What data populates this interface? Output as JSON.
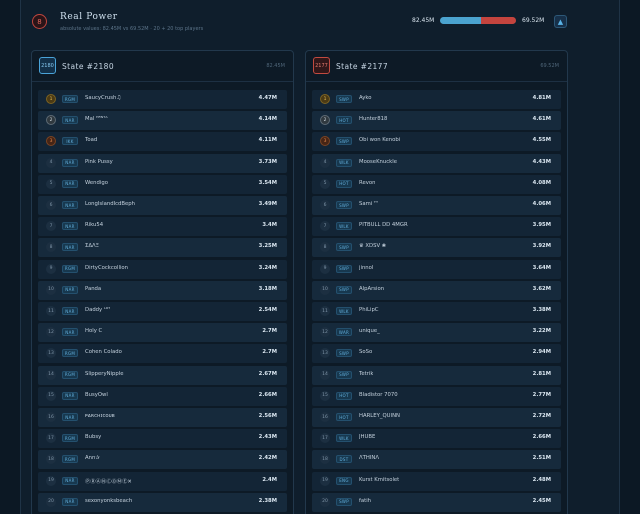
{
  "header": {
    "crest": "8",
    "title": "Real Power",
    "subtitle": "absolute values: 82.45M vs 69.52M · 20 + 20 top players",
    "left_value": "82.45M",
    "right_value": "69.52M",
    "power_split": 0.5425,
    "collapse_icon": "▲",
    "colors": {
      "left": "#4ba3cf",
      "right": "#c4443e"
    }
  },
  "left": {
    "badge": "2180",
    "title": "State #2180",
    "total": "82.45M",
    "players": [
      {
        "rank": "1",
        "tag": "RGM",
        "name": "SaucyCrush♫",
        "value": "4.47M"
      },
      {
        "rank": "2",
        "tag": "NAR",
        "name": "Mal ᴴᴿᴺᵀᴬ",
        "value": "4.14M"
      },
      {
        "rank": "3",
        "tag": "IKK",
        "name": "Toad",
        "value": "4.11M"
      },
      {
        "rank": "4",
        "tag": "NAR",
        "name": "Pink Pussy",
        "value": "3.73M"
      },
      {
        "rank": "5",
        "tag": "NAR",
        "name": "Wendigo",
        "value": "3.54M"
      },
      {
        "rank": "6",
        "tag": "NAR",
        "name": "LongIslandIcdBeph",
        "value": "3.49M"
      },
      {
        "rank": "7",
        "tag": "NAR",
        "name": "Riku54",
        "value": "3.4M"
      },
      {
        "rank": "8",
        "tag": "NAR",
        "name": "ΣΔΛΞ",
        "value": "3.25M"
      },
      {
        "rank": "9",
        "tag": "RGM",
        "name": "DirtyCockcollion",
        "value": "3.24M"
      },
      {
        "rank": "10",
        "tag": "NAR",
        "name": "Panda",
        "value": "3.18M"
      },
      {
        "rank": "11",
        "tag": "NAR",
        "name": "Daddy ᴸᴼᵀ",
        "value": "2.54M"
      },
      {
        "rank": "12",
        "tag": "NAR",
        "name": "Holy C",
        "value": "2.7M"
      },
      {
        "rank": "13",
        "tag": "RGM",
        "name": "Cohen Colado",
        "value": "2.7M"
      },
      {
        "rank": "14",
        "tag": "RGM",
        "name": "SlipperyNipple",
        "value": "2.67M"
      },
      {
        "rank": "15",
        "tag": "NAR",
        "name": "BusyOwl",
        "value": "2.66M"
      },
      {
        "rank": "16",
        "tag": "NAR",
        "name": "ᴘᴀʀᴄʜɪᴄᴏᴜʙ",
        "value": "2.56M"
      },
      {
        "rank": "17",
        "tag": "RGM",
        "name": "Bubsy",
        "value": "2.43M"
      },
      {
        "rank": "18",
        "tag": "RGM",
        "name": "Ann✰",
        "value": "2.42M"
      },
      {
        "rank": "19",
        "tag": "NAR",
        "name": "ⓅⓇⒶⓃⒸⓄⓂⒺ✕",
        "value": "2.4M"
      },
      {
        "rank": "20",
        "tag": "NAR",
        "name": "sexonyonksbeach",
        "value": "2.38M"
      }
    ]
  },
  "right": {
    "badge": "2177",
    "title": "State #2177",
    "total": "69.52M",
    "players": [
      {
        "rank": "1",
        "tag": "SWP",
        "name": "Ayko",
        "value": "4.81M"
      },
      {
        "rank": "2",
        "tag": "HOT",
        "name": "Hunter818",
        "value": "4.61M"
      },
      {
        "rank": "3",
        "tag": "SWP",
        "name": "Obi won Kenobi",
        "value": "4.55M"
      },
      {
        "rank": "4",
        "tag": "WLK",
        "name": "MooseKnuckle",
        "value": "4.43M"
      },
      {
        "rank": "5",
        "tag": "HOT",
        "name": "Revon",
        "value": "4.08M"
      },
      {
        "rank": "6",
        "tag": "SWP",
        "name": "Sami ᵀᵀ",
        "value": "4.06M"
      },
      {
        "rank": "7",
        "tag": "WLK",
        "name": "PITBULL DD 4MGR",
        "value": "3.95M"
      },
      {
        "rank": "8",
        "tag": "SWP",
        "name": "♛ XDSV ❀",
        "value": "3.92M"
      },
      {
        "rank": "9",
        "tag": "SWP",
        "name": "jinnol",
        "value": "3.64M"
      },
      {
        "rank": "10",
        "tag": "SWP",
        "name": "AlpArsion",
        "value": "3.62M"
      },
      {
        "rank": "11",
        "tag": "WLK",
        "name": "PhiLipC",
        "value": "3.38M"
      },
      {
        "rank": "12",
        "tag": "WAR",
        "name": "unique_",
        "value": "3.22M"
      },
      {
        "rank": "13",
        "tag": "SWP",
        "name": "SoSo",
        "value": "2.94M"
      },
      {
        "rank": "14",
        "tag": "SWP",
        "name": "Tetrik",
        "value": "2.81M"
      },
      {
        "rank": "15",
        "tag": "HOT",
        "name": "Bladistor 7070",
        "value": "2.77M"
      },
      {
        "rank": "16",
        "tag": "HOT",
        "name": "HARLEY_QUINN",
        "value": "2.72M"
      },
      {
        "rank": "17",
        "tag": "WLK",
        "name": "JHUBE",
        "value": "2.66M"
      },
      {
        "rank": "18",
        "tag": "DST",
        "name": "ΛТΗΙΝΛ",
        "value": "2.51M"
      },
      {
        "rank": "19",
        "tag": "ENG",
        "name": "Kurst Kmitsolet",
        "value": "2.48M"
      },
      {
        "rank": "20",
        "tag": "SWP",
        "name": "fatih",
        "value": "2.45M"
      }
    ]
  }
}
